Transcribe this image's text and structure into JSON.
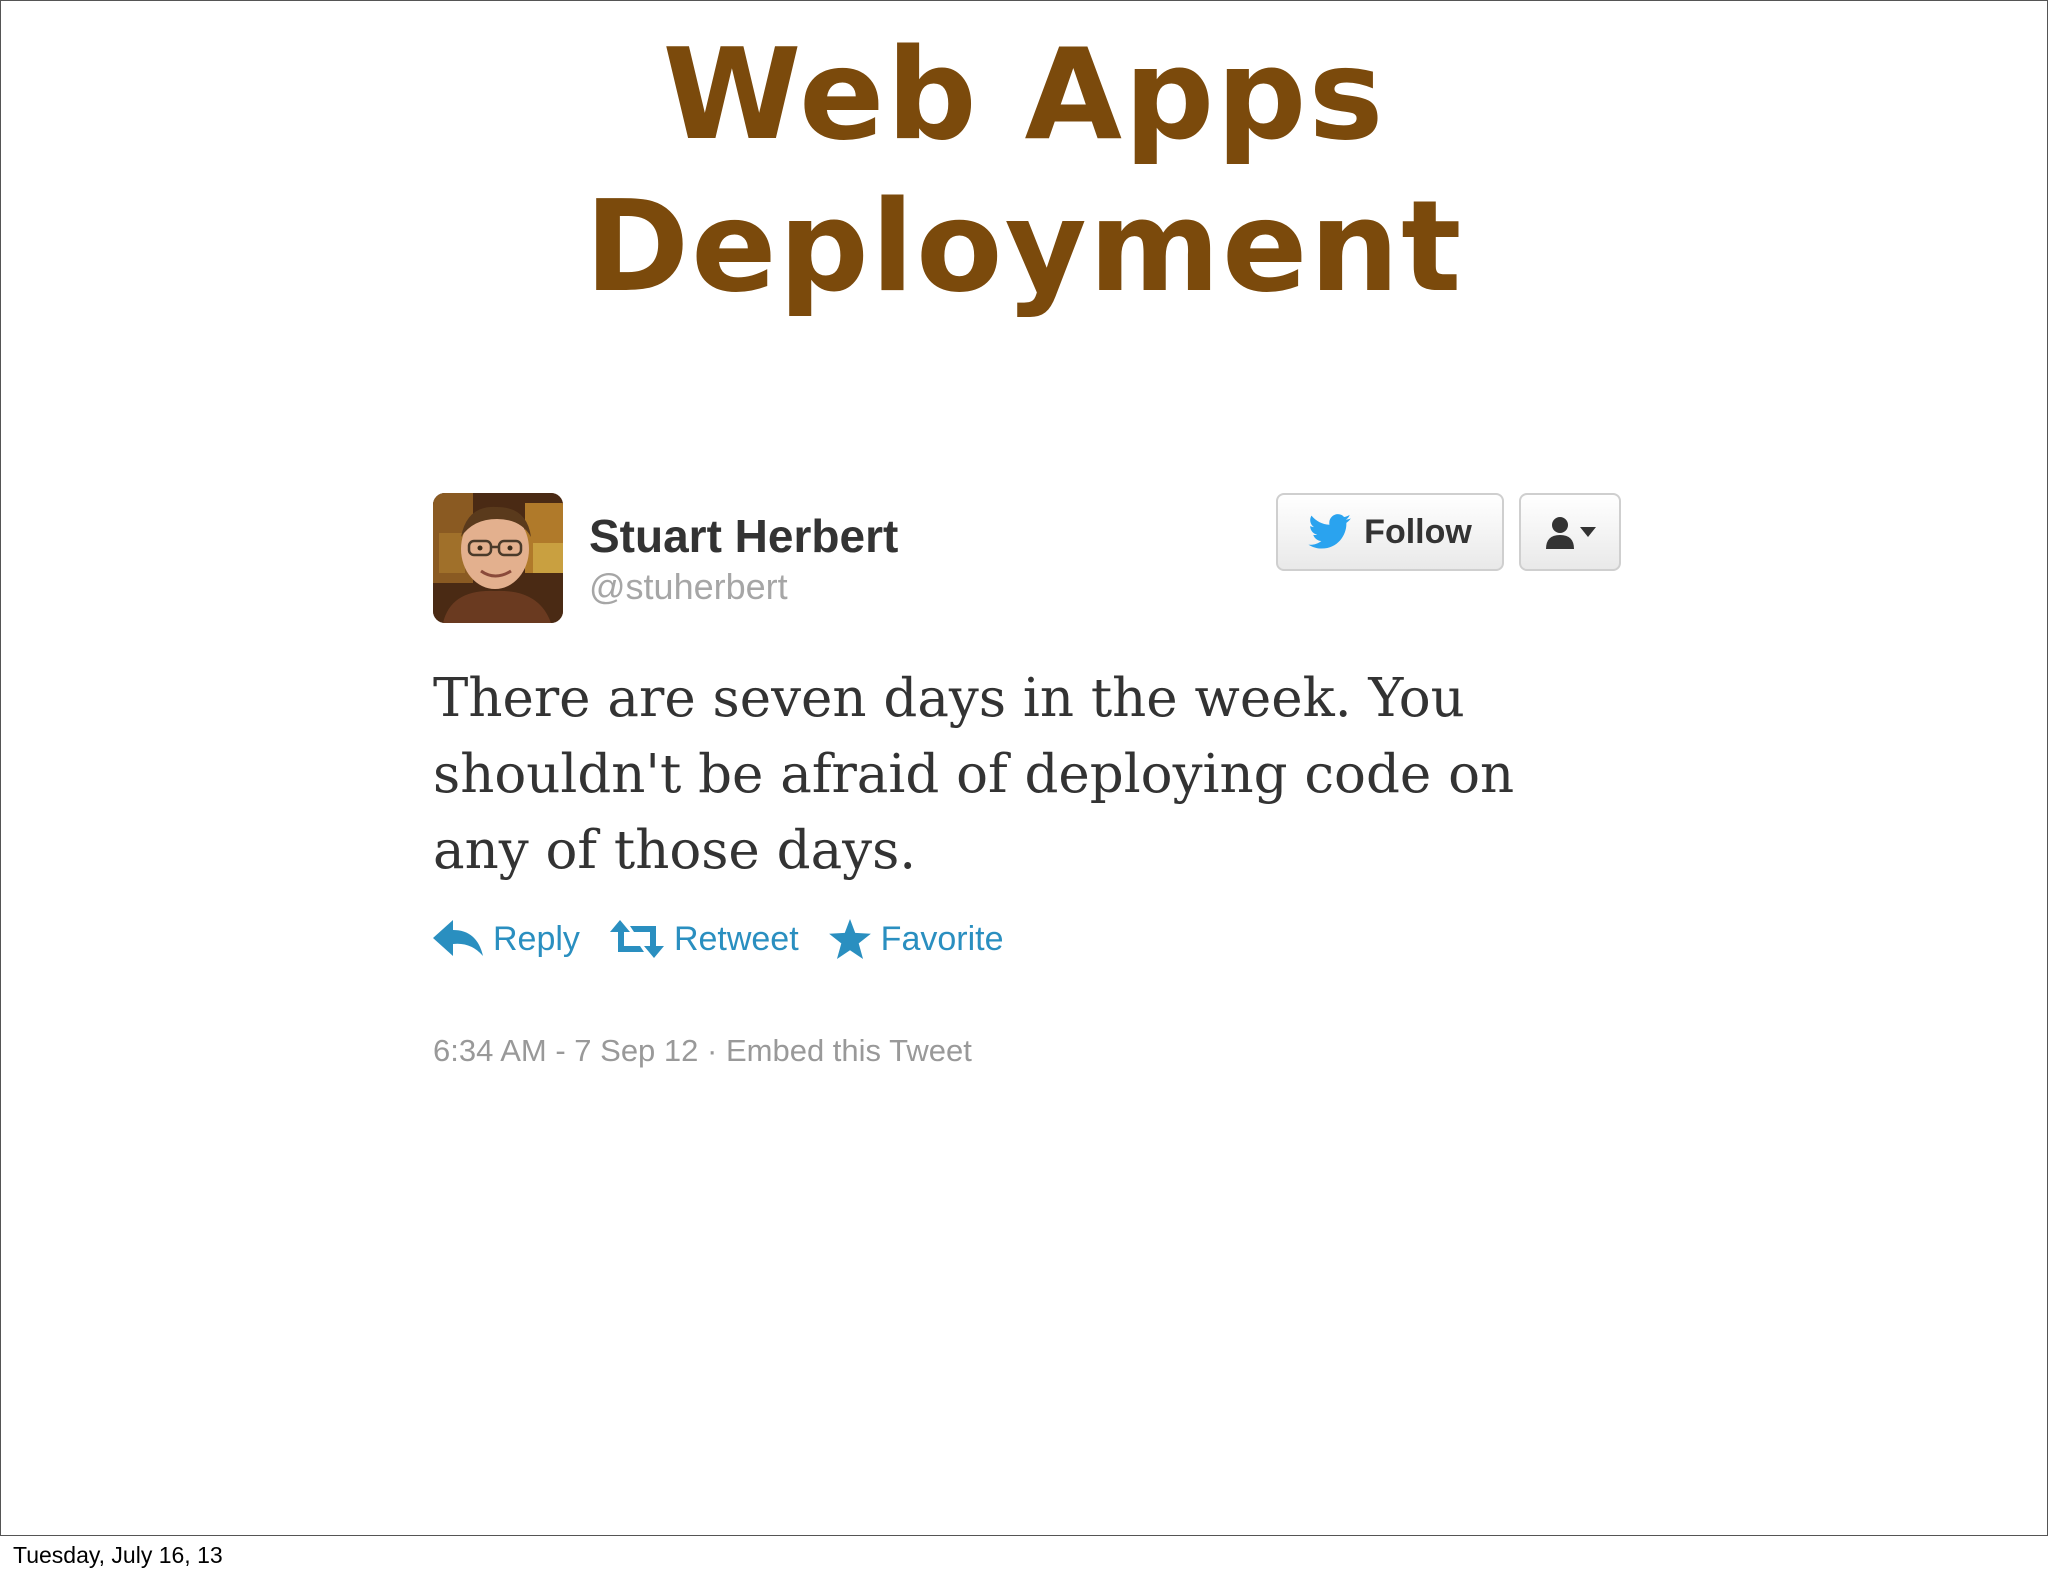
{
  "slide": {
    "title_line1": "Web Apps",
    "title_line2": "Deployment",
    "title_color": "#7b4a0c"
  },
  "tweet": {
    "avatar_icon": "user-photo",
    "display_name": "Stuart Herbert",
    "handle": "@stuherbert",
    "follow_label": "Follow",
    "follow_icon": "twitter-bird-icon",
    "user_menu_icon": "user-dropdown-icon",
    "text": "There are seven days in the week. You shouldn't be afraid of deploying code on any of those days.",
    "actions": {
      "reply": "Reply",
      "retweet": "Retweet",
      "favorite": "Favorite"
    },
    "action_color": "#2a8fc0",
    "timestamp": "6:34 AM - 7 Sep 12",
    "separator": " · ",
    "embed_label": "Embed this Tweet"
  },
  "footer": {
    "date": "Tuesday, July 16, 13"
  }
}
